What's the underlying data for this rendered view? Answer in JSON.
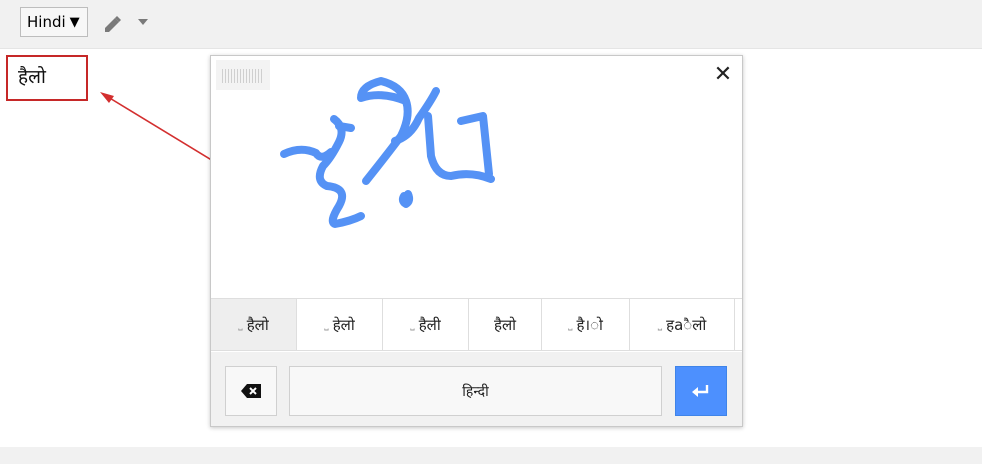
{
  "toolbar": {
    "language_label": "Hindi",
    "language_caret": "▼",
    "pencil_icon": "pencil-icon",
    "dropdown_icon": "chevron-down-icon"
  },
  "editor": {
    "text": "हैलो",
    "highlight_color": "#c62828"
  },
  "handwriting_panel": {
    "close_label": "✕",
    "stroke_color": "#5592f5",
    "candidates": [
      {
        "text": "हैलो",
        "leading_space": true,
        "selected": true
      },
      {
        "text": "हेलो",
        "leading_space": true,
        "selected": false
      },
      {
        "text": "हैली",
        "leading_space": true,
        "selected": false
      },
      {
        "text": "हैलो",
        "leading_space": false,
        "selected": false
      },
      {
        "text": "है।ो",
        "leading_space": true,
        "selected": false
      },
      {
        "text": "हaैलो",
        "leading_space": true,
        "selected": false
      }
    ],
    "space_symbol": "⎵",
    "space_key_label": "हिन्दी",
    "backspace_icon": "backspace-icon",
    "enter_icon": "enter-icon",
    "enter_color": "#4d90fe"
  }
}
